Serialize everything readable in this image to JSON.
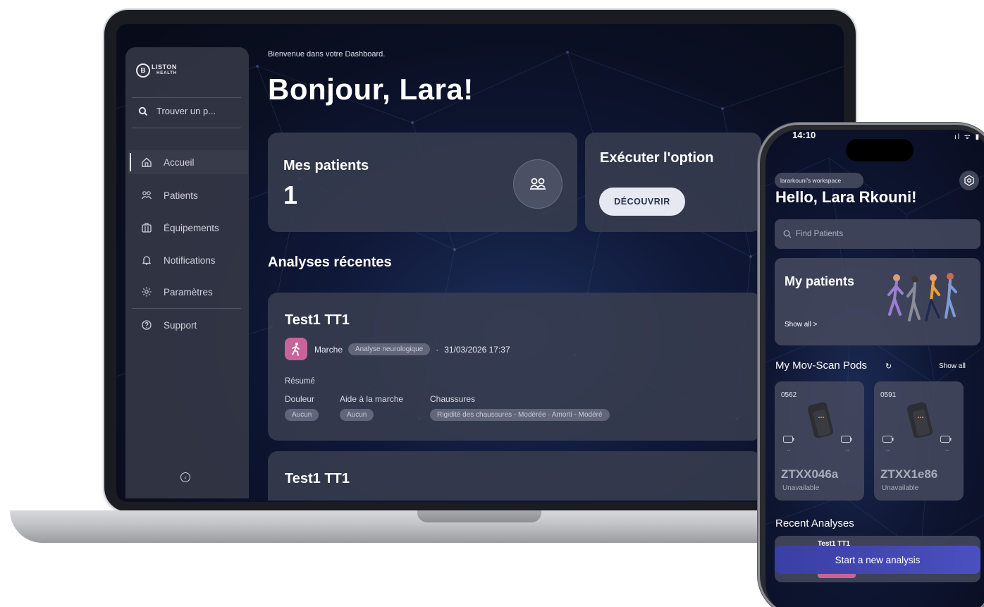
{
  "laptop": {
    "brand": {
      "mark": "B",
      "name": "LISTON",
      "sub": "HEALTH"
    },
    "sidebar": {
      "search_placeholder": "Trouver un p...",
      "items": [
        {
          "label": "Accueil",
          "icon": "home-icon",
          "active": true
        },
        {
          "label": "Patients",
          "icon": "patients-icon"
        },
        {
          "label": "Équipements",
          "icon": "equipment-icon"
        },
        {
          "label": "Notifications",
          "icon": "bell-icon"
        },
        {
          "label": "Paramètres",
          "icon": "settings-icon"
        },
        {
          "label": "Support",
          "icon": "help-icon"
        }
      ],
      "collapse_glyph": "‹"
    },
    "header": {
      "welcome": "Bienvenue dans votre Dashboard.",
      "greeting": "Bonjour, Lara!"
    },
    "patients_card": {
      "title": "Mes patients",
      "count": "1"
    },
    "option_card": {
      "title": "Exécuter l'option",
      "button": "DÉCOUVRIR"
    },
    "recent": {
      "title": "Analyses récentes",
      "items": [
        {
          "title": "Test1 TT1",
          "type": "Marche",
          "tag": "Analyse neurologique",
          "separator": "·",
          "date": "31/03/2026 17:37",
          "summary_label": "Résumé",
          "fields": [
            {
              "label": "Douleur",
              "value": "Aucun"
            },
            {
              "label": "Aide à la marche",
              "value": "Aucun"
            },
            {
              "label": "Chaussures",
              "value": "Rigidité des chaussures - Modérée · Amorti - Modéré"
            }
          ]
        },
        {
          "title": "Test1 TT1"
        }
      ]
    }
  },
  "phone": {
    "time": "14:10",
    "status": "ıl ᯤ ▮",
    "workspace": "lararkouni's workspace",
    "greeting": "Hello, Lara Rkouni!",
    "search_placeholder": "Find Patients",
    "my_patients": {
      "title": "My patients",
      "link": "Show all >"
    },
    "pods": {
      "title": "My Mov-Scan Pods",
      "refresh_glyph": "↻",
      "show_all": "Show all",
      "items": [
        {
          "id": "0562",
          "name": "ZTXX046a",
          "status": "Unavailable",
          "left_value": "--",
          "right_value": "--"
        },
        {
          "id": "0591",
          "name": "ZTXX1e86",
          "status": "Unavailable",
          "left_value": "--",
          "right_value": "--"
        }
      ]
    },
    "recent": {
      "title": "Recent Analyses",
      "item_title": "Test1 TT1"
    },
    "start_button": "Start a new analysis"
  },
  "colors": {
    "screen_bg": "#0a0f22",
    "card_bg": "#3a3e50",
    "accent_pink": "#c8649a",
    "button_light": "#e6e9f2",
    "cta_purple": "#4b4fc0"
  }
}
